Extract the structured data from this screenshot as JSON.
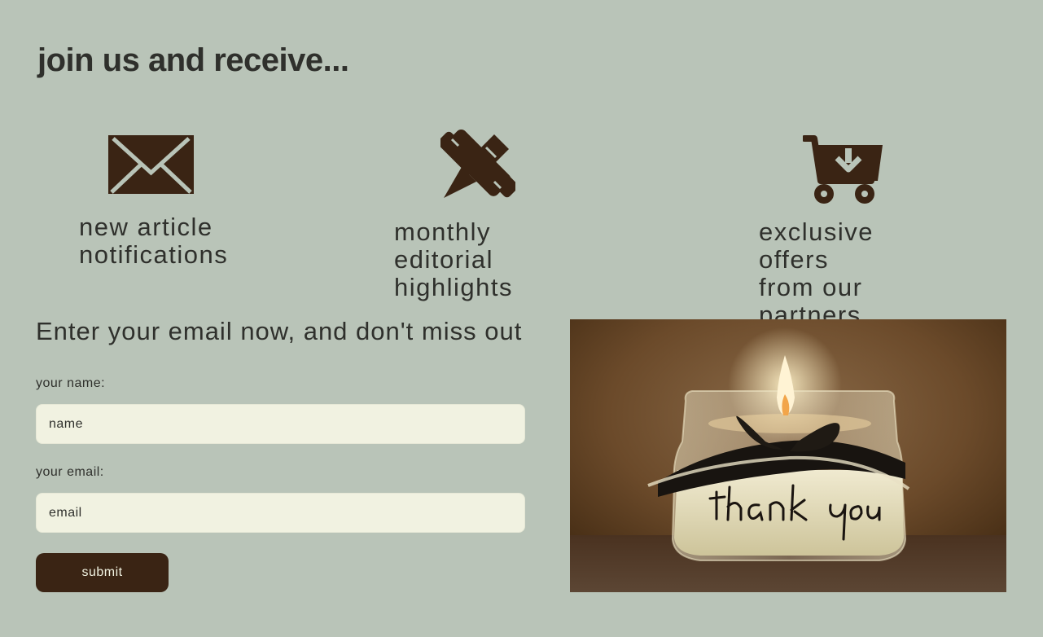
{
  "heading": "join us and receive...",
  "benefits": [
    {
      "icon": "envelope-icon",
      "label": "new article\nnotifications"
    },
    {
      "icon": "pencil-ruler-icon",
      "label": "monthly editorial\nhighlights"
    },
    {
      "icon": "cart-download-icon",
      "label": "exclusive offers\nfrom our partners"
    }
  ],
  "form": {
    "subheading": "Enter your email now, and don't miss out",
    "name_label": "your name:",
    "name_placeholder": "name",
    "email_label": "your email:",
    "email_placeholder": "email",
    "submit_label": "submit"
  },
  "photo": {
    "subject": "candle-jar-photo",
    "jar_text": "thank you"
  },
  "colors": {
    "background": "#b9c4b8",
    "accent": "#3a2414",
    "input_background": "#f1f2e1",
    "text": "#2f302c"
  }
}
